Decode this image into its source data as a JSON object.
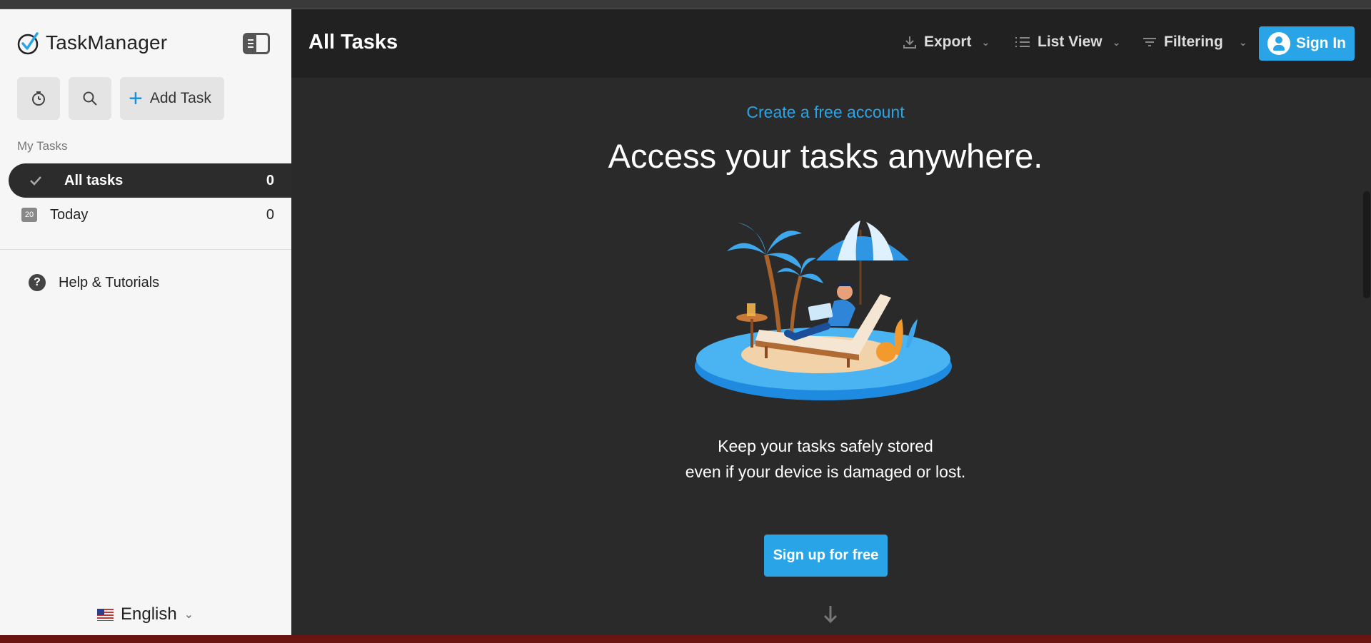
{
  "app": {
    "name": "TaskManager"
  },
  "sidebar": {
    "add_task_label": "Add Task",
    "section_label": "My Tasks",
    "items": [
      {
        "label": "All tasks",
        "count": "0",
        "active": true
      },
      {
        "label": "Today",
        "count": "0",
        "calendar_day": "20"
      }
    ],
    "help_label": "Help & Tutorials",
    "language": "English"
  },
  "header": {
    "title": "All Tasks",
    "export_label": "Export",
    "view_label": "List View",
    "filter_label": "Filtering",
    "signin_label": "Sign In"
  },
  "main": {
    "cta_link": "Create a free account",
    "headline": "Access your tasks anywhere.",
    "subtext_line1": "Keep your tasks safely stored",
    "subtext_line2": "even if your device is damaged or lost.",
    "signup_label": "Sign up for free"
  },
  "colors": {
    "accent": "#29a4e6",
    "sidebar_bg": "#f6f6f6",
    "main_bg": "#2a2a2a",
    "header_bg": "#212121"
  },
  "icons": [
    "check-logo-icon",
    "panel-toggle-icon",
    "timer-icon",
    "search-icon",
    "plus-icon",
    "check-icon",
    "calendar-icon",
    "help-icon",
    "us-flag-icon",
    "download-icon",
    "list-icon",
    "filter-icon",
    "user-icon",
    "arrow-down-icon"
  ]
}
